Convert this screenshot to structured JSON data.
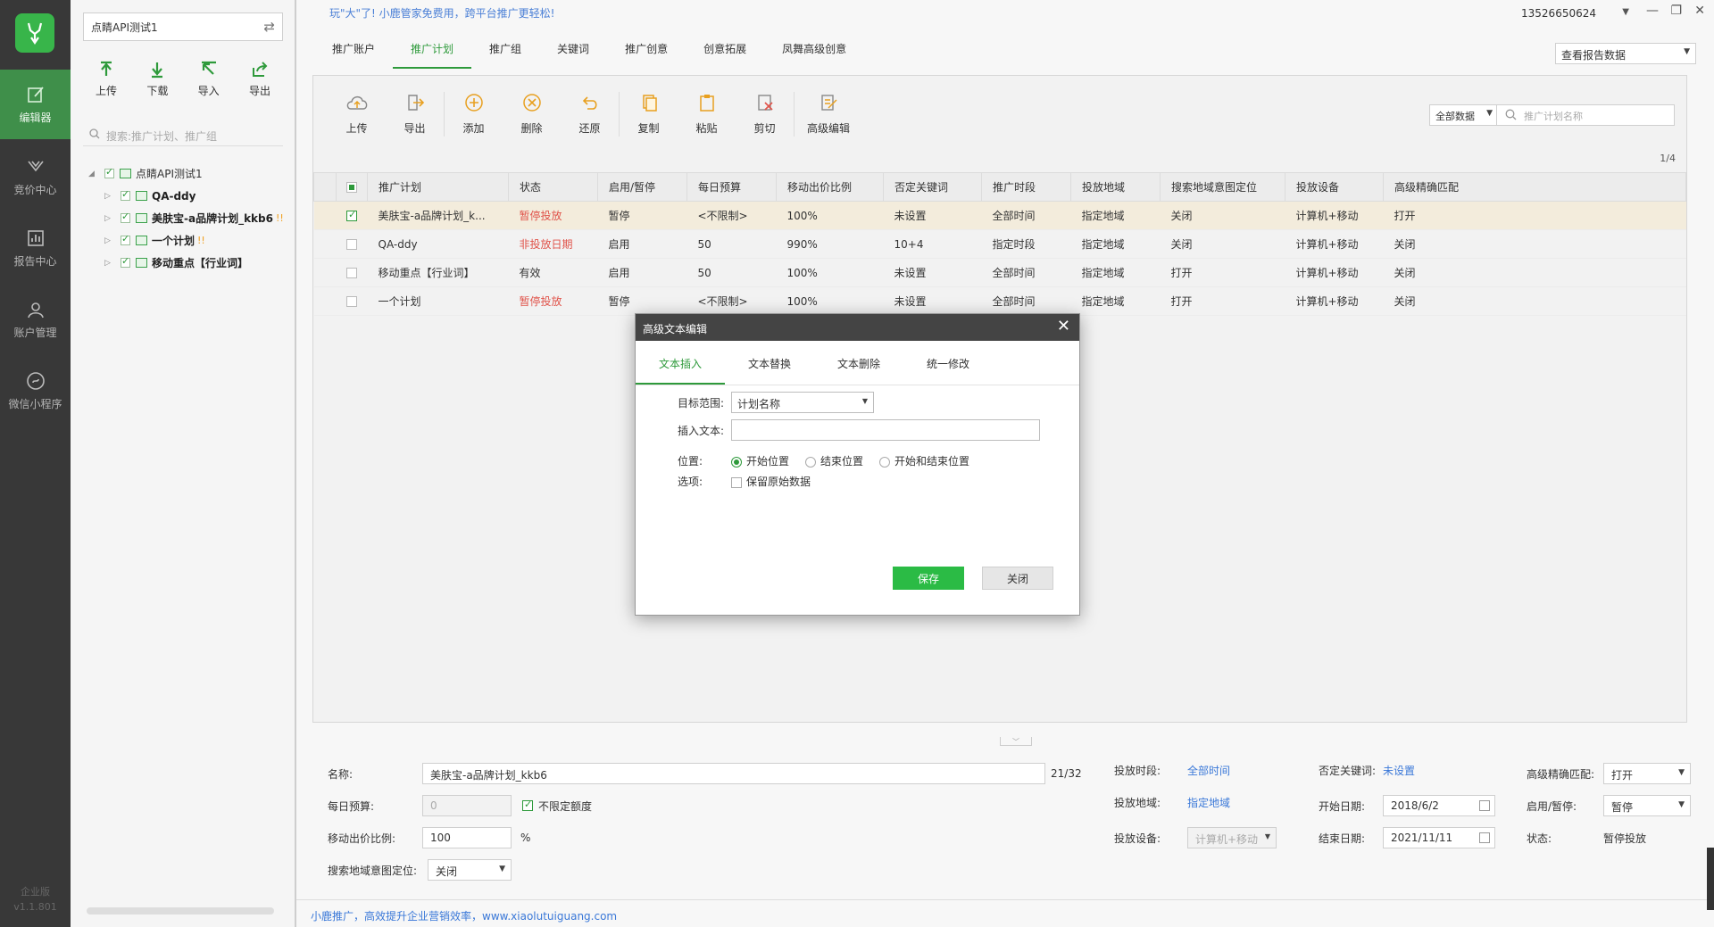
{
  "nav": {
    "items": [
      {
        "label": "编辑器",
        "icon": "edit-icon"
      },
      {
        "label": "竞价中心",
        "icon": "bid-icon"
      },
      {
        "label": "报告中心",
        "icon": "report-icon"
      },
      {
        "label": "账户管理",
        "icon": "user-icon"
      },
      {
        "label": "微信小程序",
        "icon": "miniapp-icon"
      }
    ],
    "edition": "企业版",
    "version": "v1.1.801"
  },
  "tree": {
    "account": "点睛API测试1",
    "tools": [
      "上传",
      "下载",
      "导入",
      "导出"
    ],
    "search_placeholder": "搜索:推广计划、推广组",
    "root": "点睛API测试1",
    "nodes": [
      "QA-ddy",
      "美肤宝-a品牌计划_kkb6",
      "一个计划",
      "移动重点【行业词】"
    ],
    "warn_mark": "!!"
  },
  "main": {
    "banner": "玩\"大\"了! 小鹿管家免费用，跨平台推广更轻松!",
    "tabs": [
      "推广账户",
      "推广计划",
      "推广组",
      "关键词",
      "推广创意",
      "创意拓展",
      "凤舞高级创意"
    ],
    "user": "13526650624",
    "report_select": "查看报告数据",
    "toolbar": [
      "上传",
      "导出",
      "添加",
      "删除",
      "还原",
      "复制",
      "粘贴",
      "剪切",
      "高级编辑"
    ],
    "filter": "全部数据",
    "search_placeholder": "推广计划名称",
    "page": "1/4"
  },
  "grid": {
    "headers": [
      "推广计划",
      "状态",
      "启用/暂停",
      "每日预算",
      "移动出价比例",
      "否定关键词",
      "推广时段",
      "投放地域",
      "搜索地域意图定位",
      "投放设备",
      "高级精确匹配"
    ],
    "rows": [
      {
        "cells": [
          "美肤宝-a品牌计划_k...",
          "暂停投放",
          "暂停",
          "<不限制>",
          "100%",
          "未设置",
          "全部时间",
          "指定地域",
          "关闭",
          "计算机+移动",
          "打开"
        ],
        "checked": true,
        "red": true
      },
      {
        "cells": [
          "QA-ddy",
          "非投放日期",
          "启用",
          "50",
          "990%",
          "10+4",
          "指定时段",
          "指定地域",
          "关闭",
          "计算机+移动",
          "关闭"
        ],
        "checked": false,
        "red": true
      },
      {
        "cells": [
          "移动重点【行业词】",
          "有效",
          "启用",
          "50",
          "100%",
          "未设置",
          "全部时间",
          "指定地域",
          "打开",
          "计算机+移动",
          "关闭"
        ],
        "checked": false,
        "red": false
      },
      {
        "cells": [
          "一个计划",
          "暂停投放",
          "暂停",
          "<不限制>",
          "100%",
          "未设置",
          "全部时间",
          "指定地域",
          "打开",
          "计算机+移动",
          "关闭"
        ],
        "checked": false,
        "red": true
      }
    ]
  },
  "modal": {
    "title": "高级文本编辑",
    "tabs": [
      "文本插入",
      "文本替换",
      "文本删除",
      "统一修改"
    ],
    "target_label": "目标范围:",
    "target_value": "计划名称",
    "insert_label": "插入文本:",
    "insert_value": "",
    "position_label": "位置:",
    "positions": [
      "开始位置",
      "结束位置",
      "开始和结束位置"
    ],
    "option_label": "选项:",
    "option_keep": "保留原始数据",
    "save": "保存",
    "close": "关闭"
  },
  "detail": {
    "name_label": "名称:",
    "name_value": "美肤宝-a品牌计划_kkb6",
    "name_count": "21/32",
    "budget_label": "每日预算:",
    "budget_value": "0",
    "unlimited": "不限定额度",
    "mobile_label": "移动出价比例:",
    "mobile_value": "100",
    "percent": "%",
    "geo_intent_label": "搜索地域意图定位:",
    "geo_intent_value": "关闭",
    "time_label": "投放时段:",
    "time_value": "全部时间",
    "region_label": "投放地域:",
    "region_value": "指定地域",
    "device_label": "投放设备:",
    "device_value": "计算机+移动",
    "neg_label": "否定关键词:",
    "neg_value": "未设置",
    "start_label": "开始日期:",
    "start_value": "2018/6/2",
    "end_label": "结束日期:",
    "end_value": "2021/11/11",
    "exact_label": "高级精确匹配:",
    "exact_value": "打开",
    "enable_label": "启用/暂停:",
    "enable_value": "暂停",
    "status_label": "状态:",
    "status_value": "暂停投放"
  },
  "footer": "小鹿推广，高效提升企业营销效率，www.xiaolutuiguang.com"
}
